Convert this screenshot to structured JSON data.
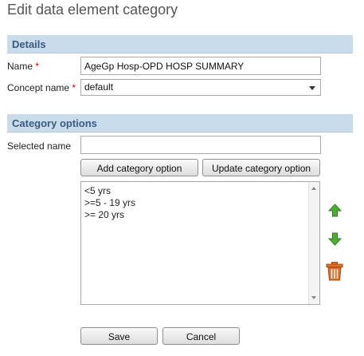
{
  "page": {
    "title": "Edit data element category"
  },
  "details": {
    "header": "Details",
    "name_label": "Name",
    "name_value": "AgeGp Hosp-OPD HOSP SUMMARY",
    "concept_label": "Concept name",
    "concept_value": "default",
    "required_mark": "*"
  },
  "category_options": {
    "header": "Category options",
    "selected_name_label": "Selected name",
    "selected_name_value": "",
    "add_button": "Add category option",
    "update_button": "Update category option",
    "options": [
      "<5 yrs",
      ">=5 - 19 yrs",
      ">= 20 yrs"
    ]
  },
  "icons": {
    "move_up": "arrow-up-icon",
    "move_down": "arrow-down-icon",
    "delete": "trash-icon",
    "colors": {
      "arrow": "#4caf2f",
      "trash": "#e0702a",
      "header_bg": "#c9dcec",
      "header_text": "#3a5a80"
    }
  },
  "footer": {
    "save_button": "Save",
    "cancel_button": "Cancel"
  }
}
